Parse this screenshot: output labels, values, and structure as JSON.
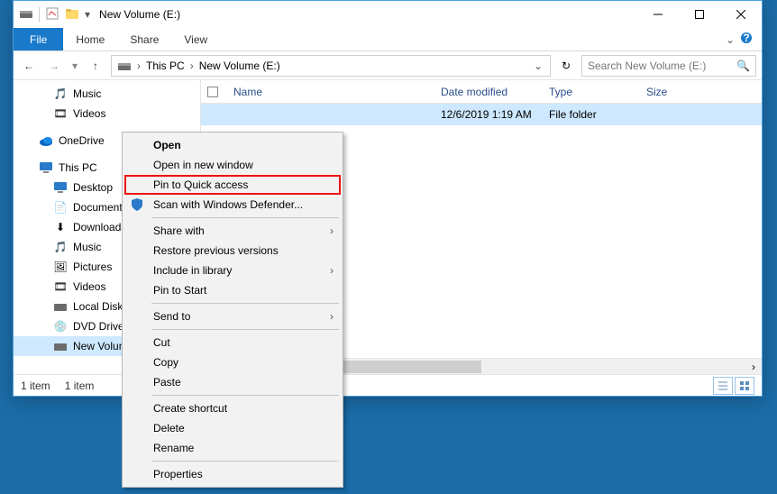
{
  "titlebar": {
    "title": "New Volume (E:)"
  },
  "ribbon": {
    "file": "File",
    "tabs": [
      "Home",
      "Share",
      "View"
    ]
  },
  "breadcrumb": {
    "root": "This PC",
    "current": "New Volume (E:)"
  },
  "search": {
    "placeholder": "Search New Volume (E:)"
  },
  "nav": {
    "top": [
      {
        "label": "Music",
        "icon": "music-icon"
      },
      {
        "label": "Videos",
        "icon": "video-icon"
      }
    ],
    "onedrive": {
      "label": "OneDrive"
    },
    "thispc": {
      "label": "This PC"
    },
    "thispc_items": [
      {
        "label": "Desktop",
        "icon": "desktop-icon"
      },
      {
        "label": "Documents",
        "icon": "documents-icon"
      },
      {
        "label": "Downloads",
        "icon": "downloads-icon"
      },
      {
        "label": "Music",
        "icon": "music-icon"
      },
      {
        "label": "Pictures",
        "icon": "pictures-icon"
      },
      {
        "label": "Videos",
        "icon": "video-icon"
      },
      {
        "label": "Local Disk",
        "icon": "drive-icon"
      },
      {
        "label": "DVD Drive",
        "icon": "dvd-icon"
      },
      {
        "label": "New Volume",
        "icon": "drive-icon",
        "selected": true
      }
    ]
  },
  "columns": {
    "name": "Name",
    "date": "Date modified",
    "type": "Type",
    "size": "Size"
  },
  "rows": [
    {
      "name": "",
      "date": "12/6/2019 1:19 AM",
      "type": "File folder",
      "size": ""
    }
  ],
  "status": {
    "count": "1 item",
    "selected": "1 item"
  },
  "context": {
    "open": "Open",
    "open_new": "Open in new window",
    "pin_qa": "Pin to Quick access",
    "defender": "Scan with Windows Defender...",
    "share": "Share with",
    "restore": "Restore previous versions",
    "library": "Include in library",
    "pin_start": "Pin to Start",
    "sendto": "Send to",
    "cut": "Cut",
    "copy": "Copy",
    "paste": "Paste",
    "shortcut": "Create shortcut",
    "delete": "Delete",
    "rename": "Rename",
    "properties": "Properties"
  }
}
